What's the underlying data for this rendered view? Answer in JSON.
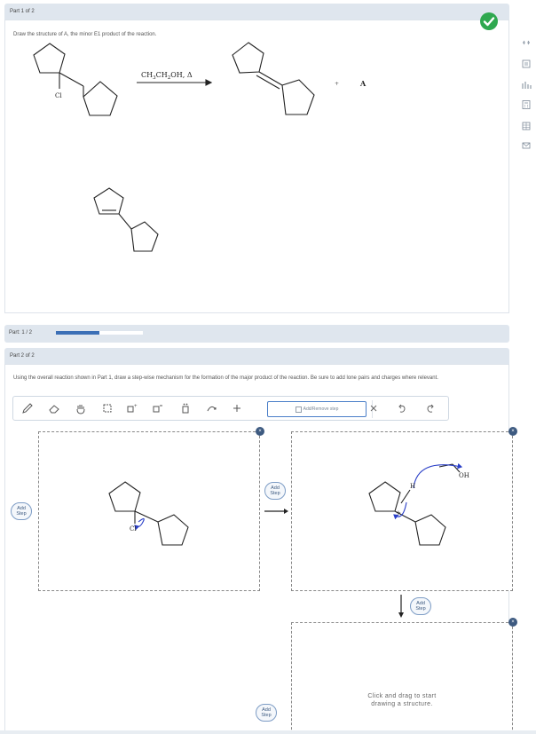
{
  "part1": {
    "header": "Part 1 of 2",
    "prompt": "Draw the structure of A, the minor E1 product of the reaction.",
    "conditions": "CH3CH2OH, Δ",
    "conditions_main": "CH",
    "conditions_sub1": "3",
    "conditions_mid": "CH",
    "conditions_sub2": "2",
    "conditions_tail": "OH, Δ",
    "reactant_label": "Cl",
    "plus": "+",
    "product_label": "A",
    "status": "correct"
  },
  "progress": {
    "label": "Part: 1 / 2",
    "fraction": 0.5
  },
  "part2": {
    "header": "Part 2 of 2",
    "prompt": "Using the overall reaction shown in Part 1, draw a step-wise mechanism for the formation of the major product of the reaction. Be sure to add lone pairs and charges where relevant."
  },
  "toolbar": {
    "tools": [
      "pencil-icon",
      "eraser-icon",
      "hand-icon",
      "select-icon",
      "add-charge-icon",
      "remove-charge-icon",
      "lone-pair-icon",
      "curved-arrow-icon",
      "plus-icon"
    ],
    "add_remove_label": "Add/Remove step",
    "actions": [
      "close-icon",
      "undo-icon",
      "redo-icon"
    ]
  },
  "steps": {
    "step1_label": "Cl",
    "step2_labels": {
      "oh": "OH",
      "h": "H",
      "charge": "+"
    },
    "add_step_label_line1": "Add",
    "add_step_label_line2": "Step",
    "close": "×",
    "placeholder_line1": "Click and drag to start",
    "placeholder_line2": "drawing a structure."
  },
  "side_icons": [
    "link-icon",
    "notes-icon",
    "periodic-table-icon",
    "calculator-icon",
    "reference-icon",
    "message-icon"
  ],
  "colors": {
    "accent": "#3b6fb6",
    "success": "#2fa84f",
    "header_bg": "#dfe6ee",
    "arrow_blue": "#2a3fc7",
    "close_dot": "#3d5a80"
  }
}
